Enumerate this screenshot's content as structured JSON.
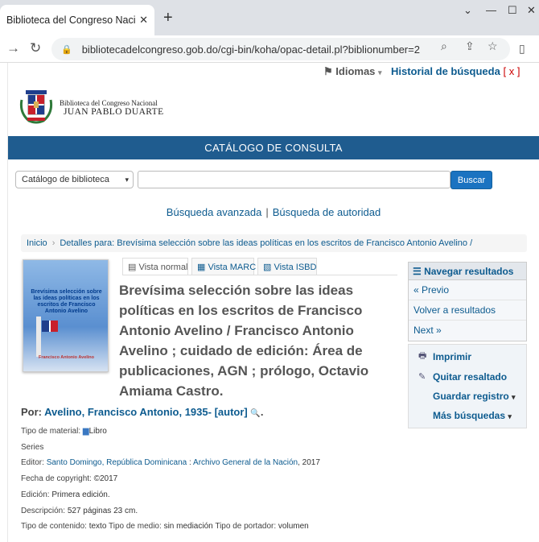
{
  "browser": {
    "tab_title": "Biblioteca del Congreso Naciona",
    "url": "bibliotecadelcongreso.gob.do/cgi-bin/koha/opac-detail.pl?biblionumber=2..."
  },
  "header": {
    "languages": "Idiomas",
    "history": "Historial de búsqueda",
    "history_close": "x",
    "logo_line1": "Biblioteca del Congreso Nacional",
    "logo_line2": "JUAN PABLO DUARTE",
    "catalog_bar": "CATÁLOGO DE CONSULTA"
  },
  "search": {
    "scope": "Catálogo de biblioteca",
    "button": "Buscar",
    "advanced": "Búsqueda avanzada",
    "authority": "Búsqueda de autoridad"
  },
  "breadcrumb": {
    "home": "Inicio",
    "details": "Detalles para: Brevísima selección sobre las ideas políticas en los escritos de Francisco Antonio Avelino /"
  },
  "cover": {
    "title": "Brevísima selección sobre las ideas políticas en los escritos de Francisco Antonio Avelino",
    "author": "Francisco Antonio Avelino"
  },
  "view_tabs": [
    "Vista normal",
    "Vista MARC",
    "Vista ISBD"
  ],
  "record": {
    "title": "Brevísima selección sobre las ideas políticas en los escritos de Francisco Antonio Avelino / Francisco Antonio Avelino ; cuidado de edición: Área de publicaciones, AGN ; prólogo, Octavio Amiama Castro.",
    "author_label": "Por:",
    "author": "Avelino, Francisco Antonio, 1935-",
    "author_role": "[autor]",
    "material_label": "Tipo de material:",
    "material": "Libro",
    "series_label": "Series",
    "publisher_label": "Editor:",
    "publisher_place": "Santo Domingo, República Dominicana",
    "publisher_name": "Archivo General de la Nación",
    "publisher_year": "2017",
    "copyright_label": "Fecha de copyright:",
    "copyright": "©2017",
    "edition_label": "Edición:",
    "edition": "Primera edición.",
    "description_label": "Descripción:",
    "description": "527 páginas 23 cm.",
    "content_label": "Tipo de contenido:",
    "content": "texto",
    "media_label": "Tipo de medio:",
    "media": "sin mediación",
    "carrier_label": "Tipo de portador:",
    "carrier": "volumen"
  },
  "sidebar": {
    "heading": "Navegar resultados",
    "previous": "« Previo",
    "back": "Volver a resultados",
    "next": "Next »"
  },
  "actions": {
    "print": "Imprimir",
    "remove": "Quitar resaltado",
    "save": "Guardar registro",
    "more": "Más búsquedas"
  }
}
